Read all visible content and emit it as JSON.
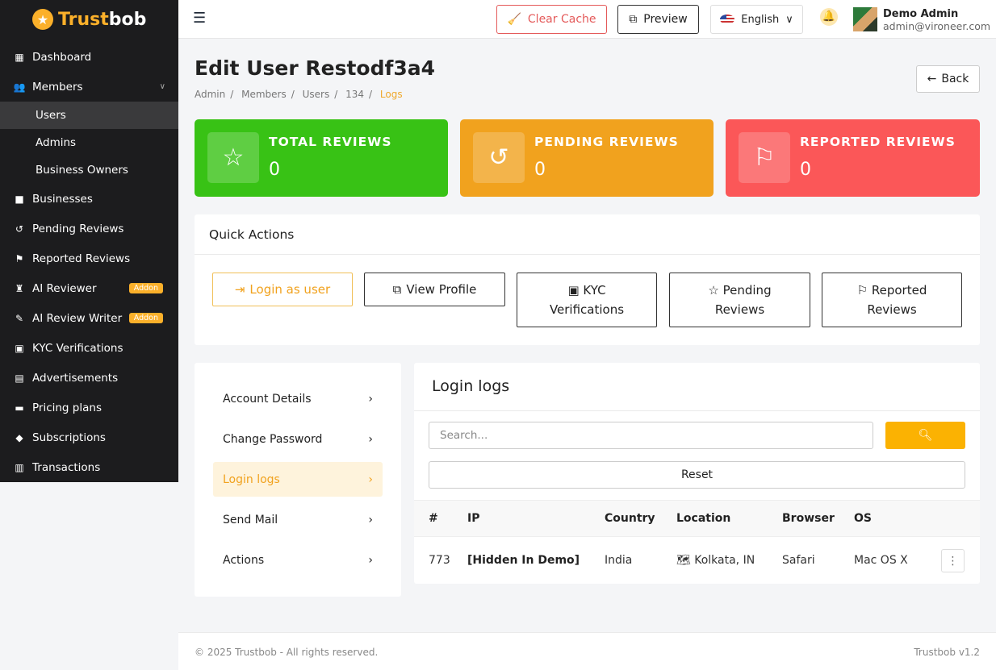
{
  "brand": {
    "part1": "Trust",
    "part2": "bob",
    "icon": "star-icon"
  },
  "sidebar": {
    "items": [
      {
        "label": "Dashboard",
        "icon": "dashboard-icon"
      },
      {
        "label": "Members",
        "icon": "members-icon"
      },
      {
        "label": "Businesses",
        "icon": "briefcase-icon"
      },
      {
        "label": "Pending Reviews",
        "icon": "history-icon"
      },
      {
        "label": "Reported Reviews",
        "icon": "flag-icon"
      },
      {
        "label": "AI Reviewer",
        "icon": "robot-icon",
        "badge": "Addon"
      },
      {
        "label": "AI Review Writer",
        "icon": "pen-icon",
        "badge": "Addon"
      },
      {
        "label": "KYC Verifications",
        "icon": "id-card-icon"
      },
      {
        "label": "Advertisements",
        "icon": "ad-icon"
      },
      {
        "label": "Pricing plans",
        "icon": "money-icon"
      },
      {
        "label": "Subscriptions",
        "icon": "gem-icon"
      },
      {
        "label": "Transactions",
        "icon": "receipt-icon"
      }
    ],
    "members_sub": [
      "Users",
      "Admins",
      "Business Owners"
    ]
  },
  "topbar": {
    "clear_cache": "Clear Cache",
    "preview": "Preview",
    "language": "English",
    "user_name": "Demo Admin",
    "user_email": "admin@vironeer.com"
  },
  "page": {
    "title": "Edit User Restodf3a4",
    "back": "Back",
    "breadcrumb": [
      "Admin",
      "Members",
      "Users",
      "134",
      "Logs"
    ]
  },
  "stats": [
    {
      "label": "TOTAL REVIEWS",
      "value": "0",
      "color": "#38c215"
    },
    {
      "label": "PENDING REVIEWS",
      "value": "0",
      "color": "#f1a21e"
    },
    {
      "label": "REPORTED REVIEWS",
      "value": "0",
      "color": "#fb5758"
    }
  ],
  "quick_actions": {
    "title": "Quick Actions",
    "login_as_user": "Login as user",
    "view_profile": "View Profile",
    "kyc_line1": "KYC",
    "kyc_line2": "Verifications",
    "pending_line1": "Pending",
    "pending_line2": "Reviews",
    "reported_line1": "Reported",
    "reported_line2": "Reviews"
  },
  "side_menu": [
    "Account Details",
    "Change Password",
    "Login logs",
    "Send Mail",
    "Actions"
  ],
  "logs": {
    "title": "Login logs",
    "search_placeholder": "Search...",
    "reset": "Reset",
    "columns": [
      "#",
      "IP",
      "Country",
      "Location",
      "Browser",
      "OS"
    ],
    "rows": [
      {
        "id": "773",
        "ip": "[Hidden In Demo]",
        "country": "India",
        "location": "Kolkata, IN",
        "browser": "Safari",
        "os": "Mac OS X"
      }
    ]
  },
  "footer": {
    "copyright": "© 2025 Trustbob - All rights reserved.",
    "version": "Trustbob v1.2"
  }
}
